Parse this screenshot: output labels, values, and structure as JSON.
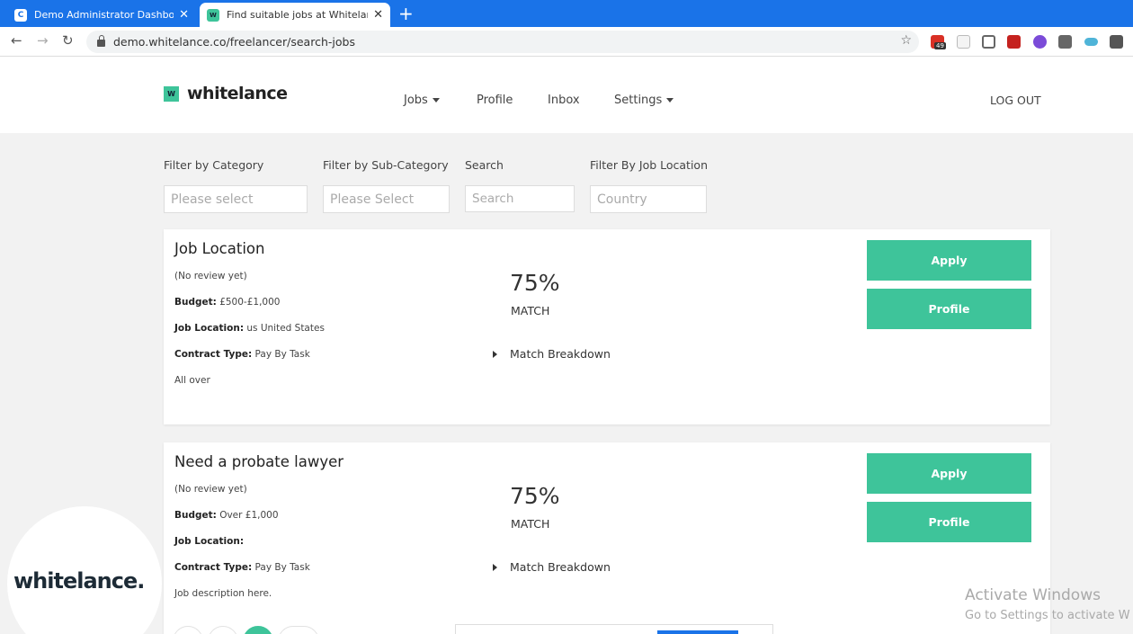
{
  "browser": {
    "tabs": [
      {
        "title": "Demo Administrator Dashboard",
        "favicon": "C",
        "active": false
      },
      {
        "title": "Find suitable jobs at Whitelance.",
        "favicon": "W",
        "active": true
      }
    ],
    "url": "demo.whitelance.co/freelancer/search-jobs",
    "extension_badge": "49"
  },
  "header": {
    "logo_mark": "W",
    "logo_text": "whitelance",
    "nav": {
      "jobs": "Jobs",
      "profile": "Profile",
      "inbox": "Inbox",
      "settings": "Settings"
    },
    "logout": "LOG OUT"
  },
  "filters": {
    "category": {
      "label": "Filter by Category",
      "placeholder": "Please select"
    },
    "subcategory": {
      "label": "Filter by Sub-Category",
      "placeholder": "Please Select"
    },
    "search": {
      "label": "Search",
      "placeholder": "Search"
    },
    "location": {
      "label": "Filter By Job Location",
      "placeholder": "Country"
    }
  },
  "jobs": [
    {
      "title": "Job Location",
      "review": "(No review yet)",
      "budget_label": "Budget:",
      "budget": " £500-£1,000",
      "location_label": "Job Location:",
      "location": " us United States",
      "contract_label": "Contract Type:",
      "contract": " Pay By Task",
      "description": "All over",
      "match_pct": "75%",
      "match_label": "MATCH",
      "breakdown": "Match Breakdown",
      "apply": "Apply",
      "profile": "Profile"
    },
    {
      "title": "Need a probate lawyer",
      "review": "(No review yet)",
      "budget_label": "Budget:",
      "budget": " Over £1,000",
      "location_label": "Job Location:",
      "location": "",
      "contract_label": "Contract Type:",
      "contract": " Pay By Task",
      "description": "Job description here.",
      "match_pct": "75%",
      "match_label": "MATCH",
      "breakdown": "Match Breakdown",
      "apply": "Apply",
      "profile": "Profile"
    }
  ],
  "overlay": {
    "badge_text": "whitelance.",
    "activate_title": "Activate Windows",
    "activate_sub": "Go to Settings to activate W"
  },
  "colors": {
    "accent": "#3ec49a",
    "tabbar": "#1a73e8"
  }
}
